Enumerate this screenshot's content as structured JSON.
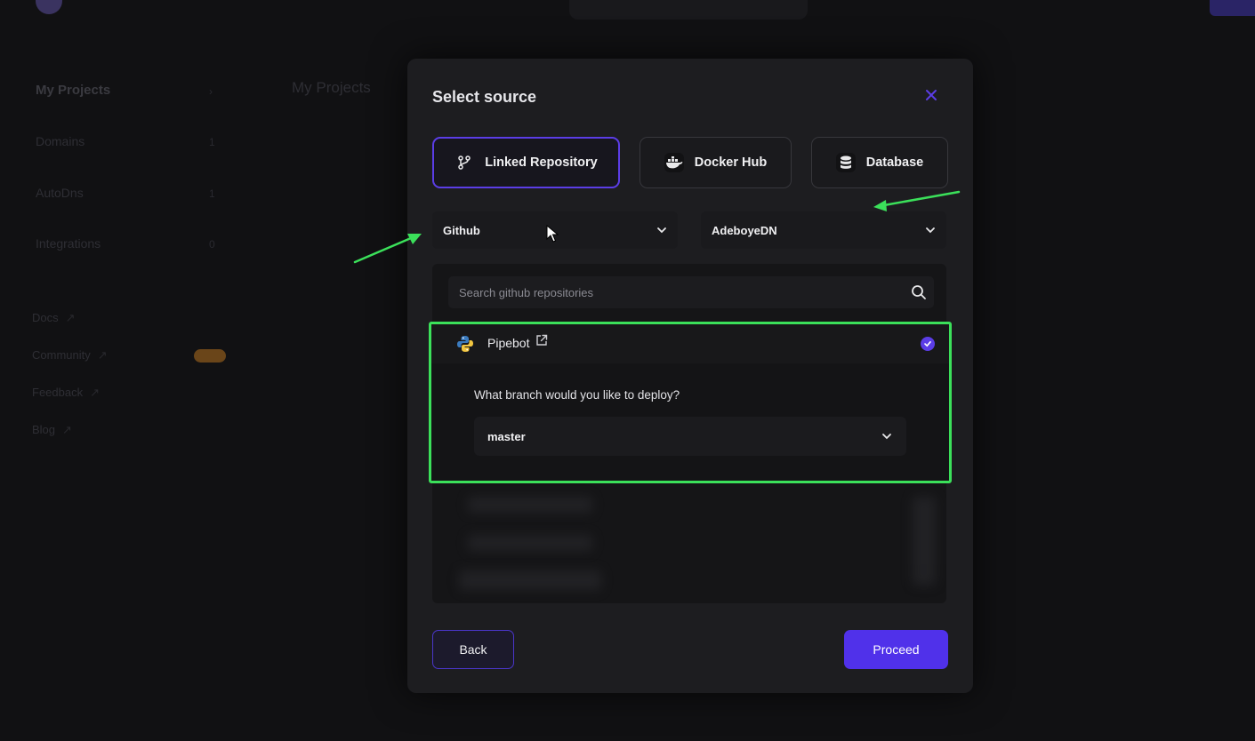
{
  "background": {
    "sidebar": {
      "title": "My Projects",
      "items": [
        {
          "label": "Domains",
          "count": "1"
        },
        {
          "label": "AutoDns",
          "count": "1"
        },
        {
          "label": "Integrations",
          "count": "0"
        }
      ],
      "links": [
        "Docs",
        "Community",
        "Feedback",
        "Blog"
      ]
    },
    "page_title": "My Projects"
  },
  "modal": {
    "title": "Select source",
    "close_icon": "close-icon",
    "tabs": [
      {
        "label": "Linked Repository",
        "icon": "git-branch-icon",
        "active": true
      },
      {
        "label": "Docker Hub",
        "icon": "docker-icon",
        "active": false
      },
      {
        "label": "Database",
        "icon": "database-icon",
        "active": false
      }
    ],
    "provider_select": {
      "value": "Github"
    },
    "account_select": {
      "value": "AdeboyeDN"
    },
    "search": {
      "placeholder": "Search github repositories"
    },
    "repo": {
      "name": "Pipebot",
      "selected": true,
      "branch_question": "What branch would you like to deploy?",
      "branch_value": "master"
    },
    "back_label": "Back",
    "proceed_label": "Proceed"
  },
  "colors": {
    "accent": "#5031ea",
    "highlight": "#3be05a",
    "modal_bg": "#1d1d20"
  }
}
